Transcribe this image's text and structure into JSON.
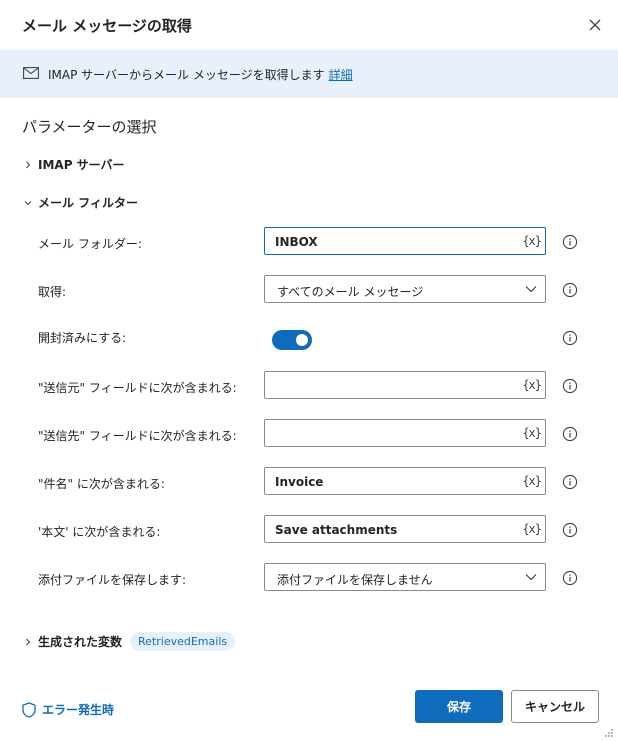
{
  "dialog": {
    "title": "メール メッセージの取得",
    "close_icon": "close-icon"
  },
  "info": {
    "text": "IMAP サーバーからメール メッセージを取得します",
    "link": "詳細",
    "icon": "mail-icon"
  },
  "section_title": "パラメーターの選択",
  "groups": {
    "imap": "IMAP サーバー",
    "filter": "メール フィルター"
  },
  "fields": {
    "mail_folder": {
      "label": "メール フォルダー:",
      "value": "INBOX",
      "var": "{x}"
    },
    "retrieve": {
      "label": "取得:",
      "value": "すべてのメール メッセージ"
    },
    "mark_read": {
      "label": "開封済みにする:",
      "on": true
    },
    "from": {
      "label": "\"送信元\" フィールドに次が含まれる:",
      "value": "",
      "var": "{x}"
    },
    "to": {
      "label": "\"送信先\" フィールドに次が含まれる:",
      "value": "",
      "var": "{x}"
    },
    "subject": {
      "label": "\"件名\" に次が含まれる:",
      "value": "Invoice",
      "var": "{x}"
    },
    "body": {
      "label": "'本文' に次が含まれる:",
      "value": "Save attachments",
      "var": "{x}"
    },
    "attachments": {
      "label": "添付ファイルを保存します:",
      "value": "添付ファイルを保存しません"
    }
  },
  "variables": {
    "label": "生成された変数",
    "pill": "RetrievedEmails"
  },
  "footer": {
    "on_error": "エラー発生時",
    "save": "保存",
    "cancel": "キャンセル"
  },
  "colors": {
    "accent": "#0f6cbd",
    "banner_bg": "#e8f1fb"
  }
}
